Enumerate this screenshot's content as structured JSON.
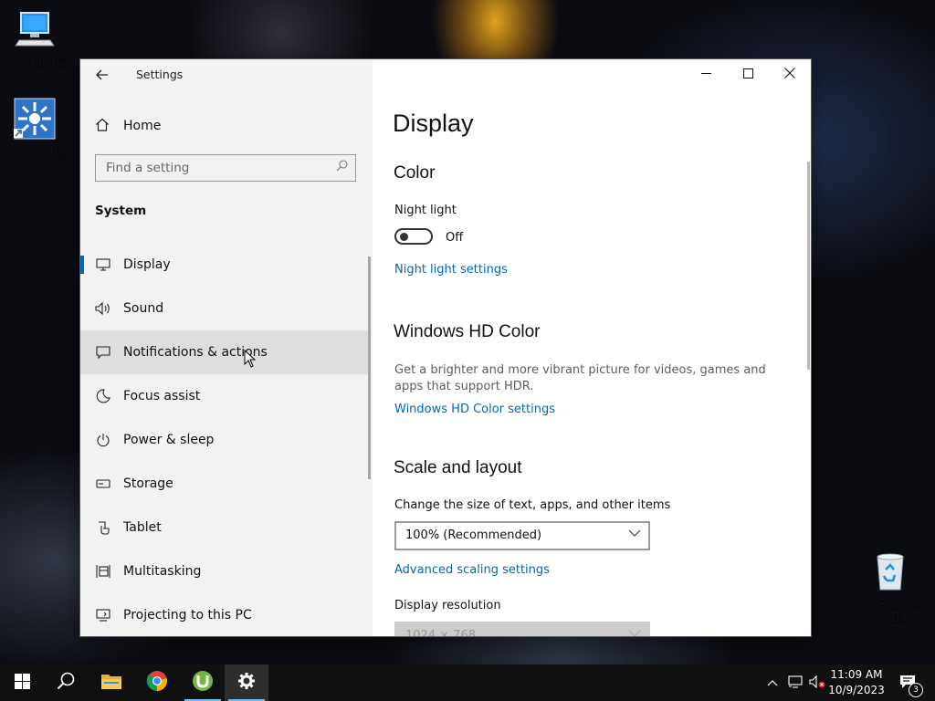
{
  "desktop": {
    "icons": [
      {
        "label": "This PC"
      },
      {
        "label": "Spydon"
      },
      {
        "label": "Recycle Bin"
      }
    ]
  },
  "window": {
    "title": "Settings",
    "home_label": "Home",
    "search_placeholder": "Find a setting",
    "section": "System",
    "nav": [
      {
        "label": "Display",
        "icon": "monitor-icon",
        "selected": true
      },
      {
        "label": "Sound",
        "icon": "speaker-icon"
      },
      {
        "label": "Notifications & actions",
        "icon": "notification-icon"
      },
      {
        "label": "Focus assist",
        "icon": "moon-icon"
      },
      {
        "label": "Power & sleep",
        "icon": "power-icon"
      },
      {
        "label": "Storage",
        "icon": "storage-icon"
      },
      {
        "label": "Tablet",
        "icon": "tablet-icon"
      },
      {
        "label": "Multitasking",
        "icon": "multitasking-icon"
      },
      {
        "label": "Projecting to this PC",
        "icon": "projecting-icon"
      }
    ]
  },
  "content": {
    "page_title": "Display",
    "color": {
      "heading": "Color",
      "night_light_label": "Night light",
      "night_light_state": "Off",
      "night_light_settings_link": "Night light settings"
    },
    "hd_color": {
      "heading": "Windows HD Color",
      "description": "Get a brighter and more vibrant picture for videos, games and apps that support HDR.",
      "link": "Windows HD Color settings"
    },
    "scale": {
      "heading": "Scale and layout",
      "change_size_label": "Change the size of text, apps, and other items",
      "scale_value": "100% (Recommended)",
      "advanced_link": "Advanced scaling settings",
      "resolution_label": "Display resolution",
      "resolution_value": "1024 × 768"
    }
  },
  "taskbar": {
    "time": "11:09 AM",
    "date": "10/9/2023",
    "notification_count": "3"
  },
  "colors": {
    "accent": "#0067c0",
    "link": "#0067b8",
    "sidebar_bg": "#f2f2f2",
    "taskbar_bg": "#101010"
  }
}
